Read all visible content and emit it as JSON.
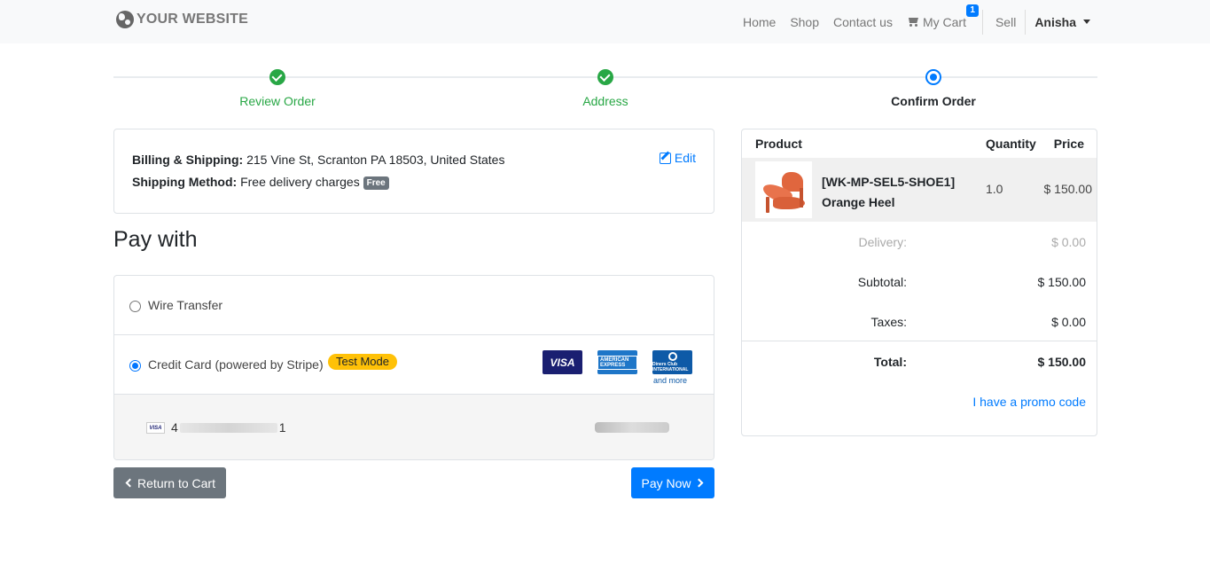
{
  "navbar": {
    "brand": "YOUR WEBSITE",
    "links": {
      "home": "Home",
      "shop": "Shop",
      "contact": "Contact us",
      "cart": "My Cart",
      "sell": "Sell"
    },
    "cart_count": "1",
    "user": "Anisha"
  },
  "wizard": {
    "steps": [
      {
        "label": "Review Order",
        "state": "done"
      },
      {
        "label": "Address",
        "state": "done"
      },
      {
        "label": "Confirm Order",
        "state": "current"
      }
    ]
  },
  "billing": {
    "label": "Billing & Shipping:",
    "address": " 215 Vine St, Scranton PA 18503, United States",
    "method_label": "Shipping Method:",
    "method": " Free delivery charges ",
    "method_badge": "Free",
    "edit": "Edit"
  },
  "payment": {
    "title": "Pay with",
    "methods": [
      {
        "label": "Wire Transfer",
        "selected": false
      },
      {
        "label": "Credit Card (powered by Stripe)",
        "selected": true,
        "badge": "Test Mode"
      }
    ],
    "card_logos": [
      "VISA",
      "AMERICAN EXPRESS",
      "Diners Club INTERNATIONAL"
    ],
    "and_more": "and more",
    "saved_card": {
      "brand": "VISA",
      "first": "4",
      "last": "1"
    }
  },
  "buttons": {
    "return": "Return to Cart",
    "pay": "Pay Now"
  },
  "summary": {
    "headers": {
      "product": "Product",
      "quantity": "Quantity",
      "price": "Price"
    },
    "item": {
      "sku": "[WK-MP-SEL5-SHOE1]",
      "name": "Orange Heel",
      "qty": "1.0",
      "price": "$ 150.00"
    },
    "delivery": {
      "label": "Delivery:",
      "value": "$ 0.00"
    },
    "subtotal": {
      "label": "Subtotal:",
      "value": "$ 150.00"
    },
    "taxes": {
      "label": "Taxes:",
      "value": "$ 0.00"
    },
    "total": {
      "label": "Total:",
      "value": "$ 150.00"
    },
    "promo": "I have a promo code"
  },
  "colors": {
    "primary": "#007bff",
    "success": "#28a745",
    "secondary": "#6c757d",
    "warning": "#ffc107"
  }
}
